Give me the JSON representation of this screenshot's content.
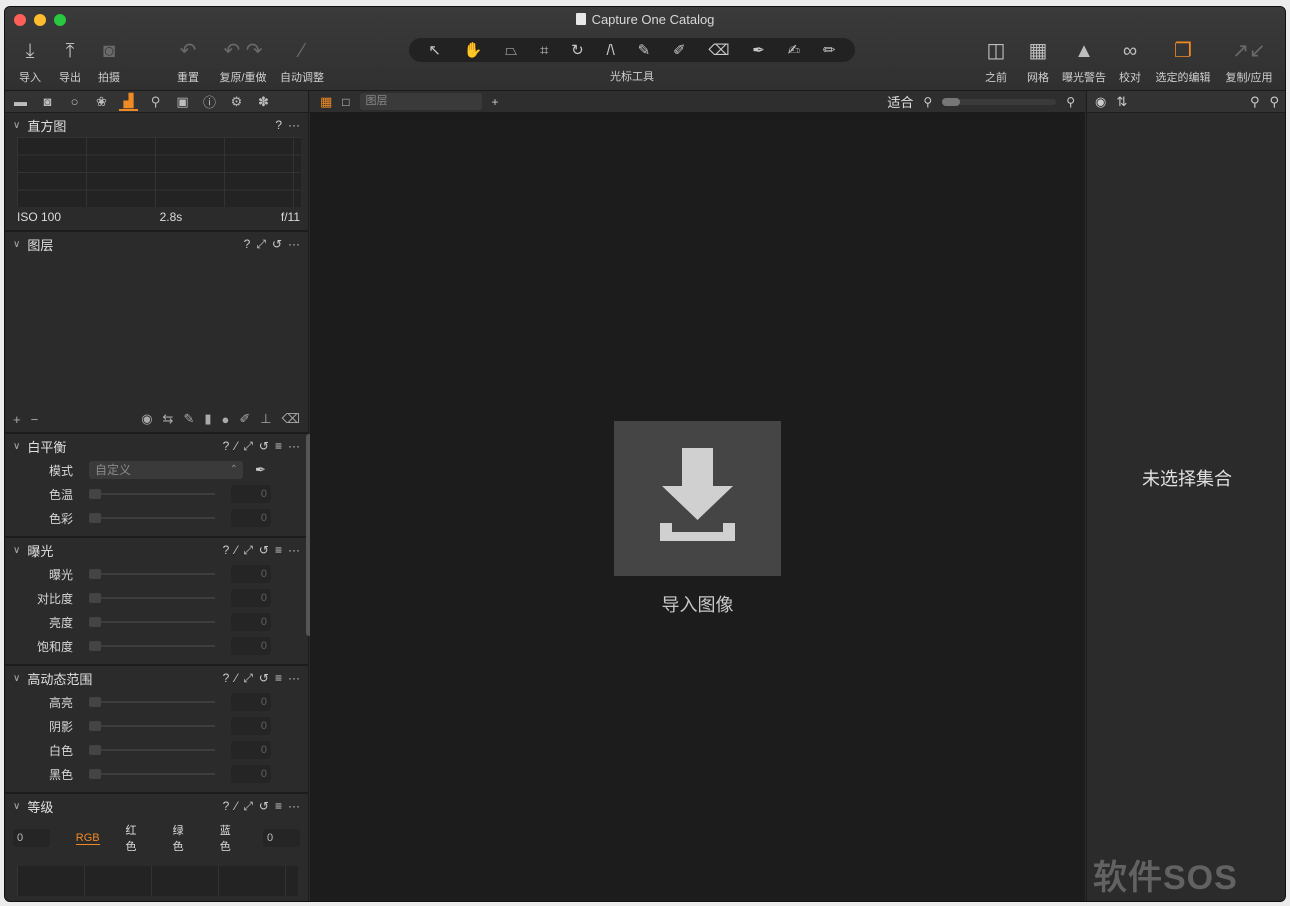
{
  "window": {
    "title": "Capture One Catalog"
  },
  "toolbar": {
    "import": "导入",
    "export": "导出",
    "capture": "拍摄",
    "reset": "重置",
    "undo_redo": "复原/重做",
    "auto_adjust": "自动调整",
    "cursor_tools_label": "光标工具",
    "before": "之前",
    "grid": "网格",
    "exposure_warning": "曝光警告",
    "proof": "校对",
    "selected_edit": "选定的编辑",
    "copy_apply": "复制/应用"
  },
  "histogram": {
    "title": "直方图",
    "iso": "ISO 100",
    "shutter": "2.8s",
    "aperture": "f/11",
    "help": "?",
    "more": "···"
  },
  "layers": {
    "title": "图层",
    "help": "?",
    "more": "···"
  },
  "white_balance": {
    "title": "白平衡",
    "help": "?",
    "more": "···",
    "mode_label": "模式",
    "mode_value": "自定义",
    "temp_label": "色温",
    "temp_value": "0",
    "tint_label": "色彩",
    "tint_value": "0"
  },
  "exposure": {
    "title": "曝光",
    "help": "?",
    "more": "···",
    "rows": [
      {
        "label": "曝光",
        "value": "0"
      },
      {
        "label": "对比度",
        "value": "0"
      },
      {
        "label": "亮度",
        "value": "0"
      },
      {
        "label": "饱和度",
        "value": "0"
      }
    ]
  },
  "hdr": {
    "title": "高动态范围",
    "help": "?",
    "more": "···",
    "rows": [
      {
        "label": "高亮",
        "value": "0"
      },
      {
        "label": "阴影",
        "value": "0"
      },
      {
        "label": "白色",
        "value": "0"
      },
      {
        "label": "黑色",
        "value": "0"
      }
    ]
  },
  "levels": {
    "title": "等级",
    "help": "?",
    "more": "···",
    "left_value": "0",
    "right_value": "0",
    "channels": [
      "RGB",
      "红色",
      "绿色",
      "蓝色"
    ]
  },
  "viewer": {
    "layer_placeholder": "图层",
    "fit": "适合",
    "import_label": "导入图像"
  },
  "browser": {
    "no_collection": "未选择集合"
  },
  "watermark": "软件SOS",
  "colors": {
    "accent": "#f08a24",
    "background": "#2b2b2b",
    "viewer_bg": "#1c1c1c"
  }
}
